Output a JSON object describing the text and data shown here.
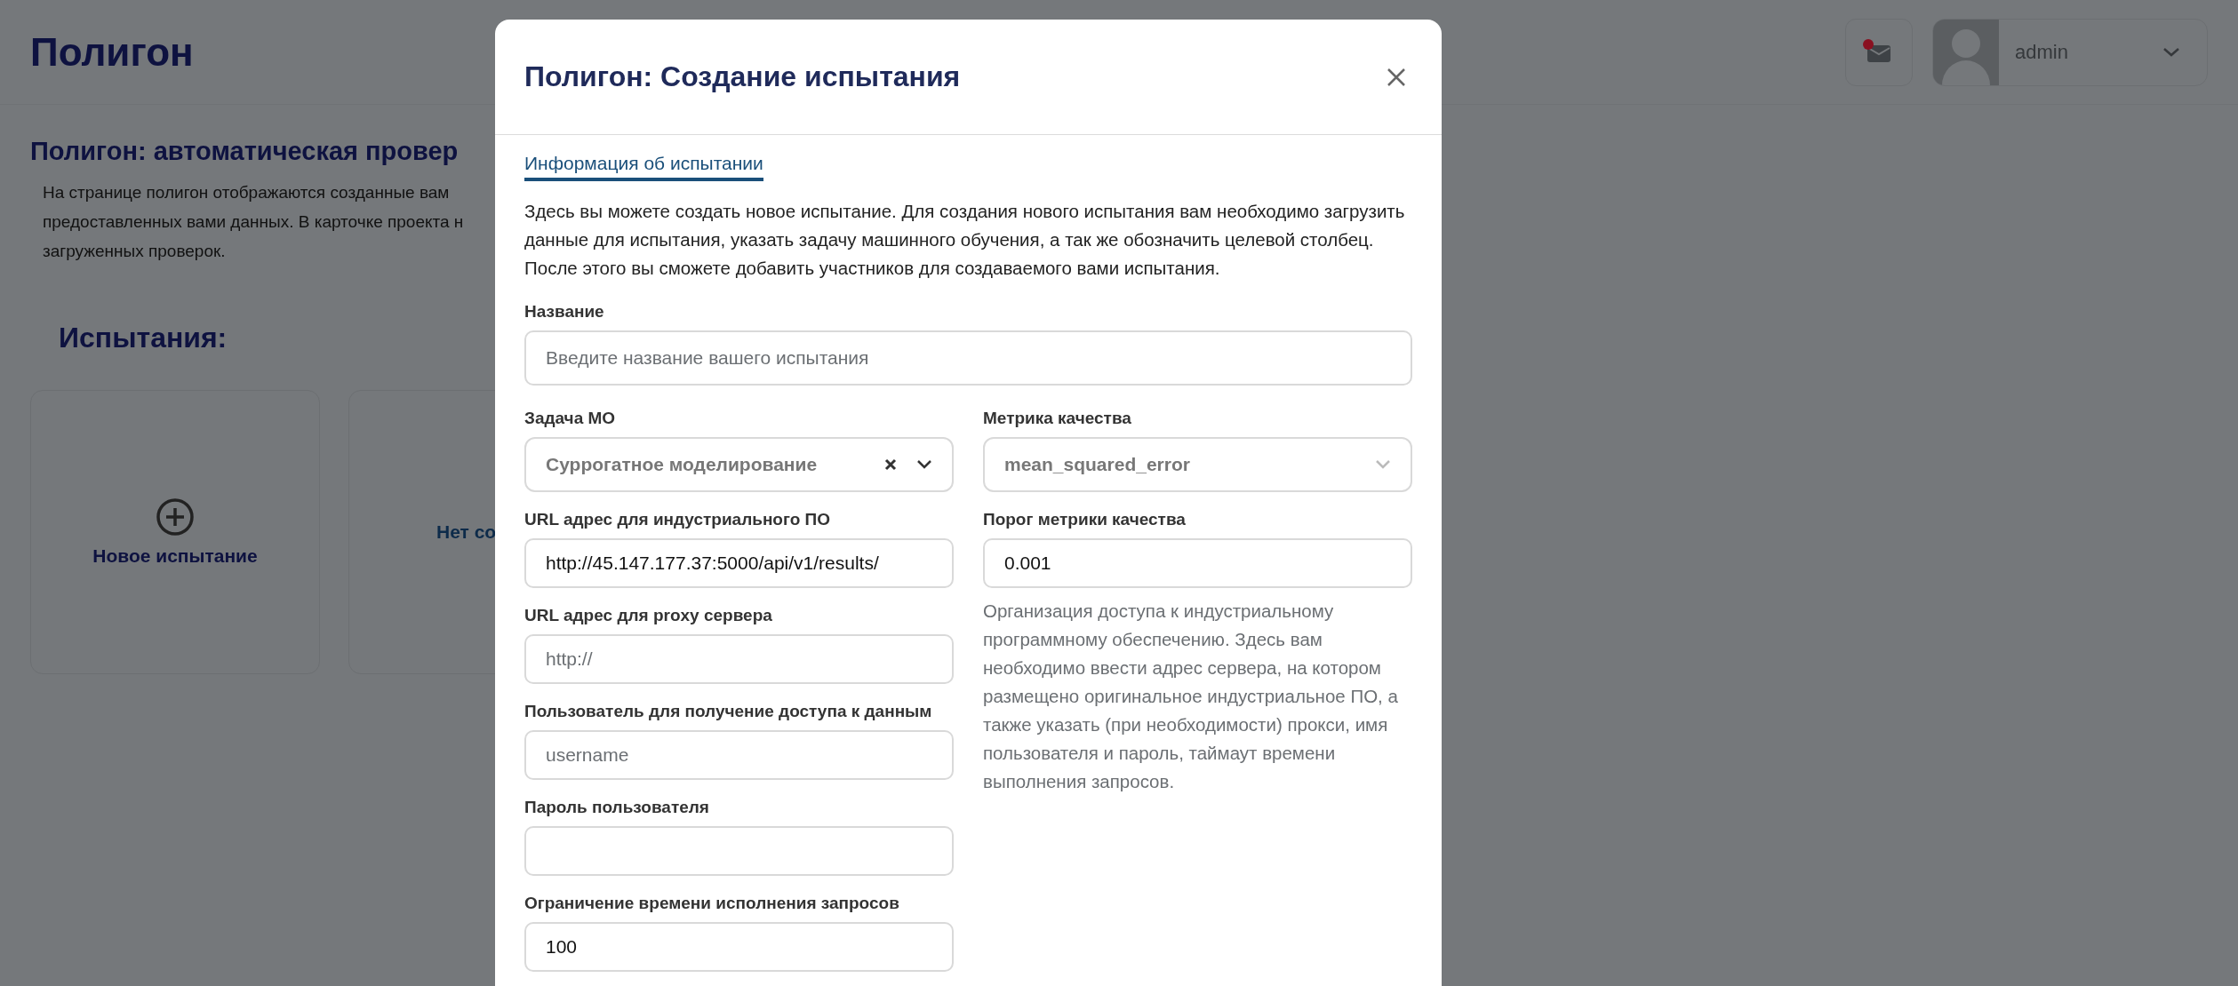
{
  "page": {
    "title": "Полигон",
    "notifications": {
      "unread": true
    },
    "user": {
      "name": "admin"
    },
    "heading": "Полигон: автоматическая провер",
    "description_lines": [
      "На странице полигон отображаются созданные вам",
      "предоставленных вами данных. В карточке проекта н",
      "загруженных проверок."
    ],
    "section_title": "Испытания:",
    "cards": [
      {
        "kind": "new",
        "label": "Новое испытание"
      },
      {
        "kind": "empty",
        "label": "Нет со"
      }
    ]
  },
  "modal": {
    "title": "Полигон: Создание испытания",
    "tabs": [
      {
        "label": "Информация об испытании",
        "selected": true
      }
    ],
    "intro": "Здесь вы можете создать новое испытание. Для создания нового испытания вам необходимо загрузить данные для испытания, указать задачу машинного обучения, а так же обозначить целевой столбец. После этого вы сможете добавить участников для создаваемого вами испытания.",
    "name_field": {
      "label": "Название",
      "placeholder": "Введите название вашего испытания"
    },
    "left_fields": [
      {
        "kind": "select",
        "label": "Задача МО",
        "value": "Суррогатное моделирование",
        "clearable": true
      },
      {
        "kind": "input",
        "label": "URL адрес для индустриального ПО",
        "value": "http://45.147.177.37:5000/api/v1/results/"
      },
      {
        "kind": "input",
        "label": "URL адрес для proxy сервера",
        "placeholder": "http://"
      },
      {
        "kind": "input",
        "label": "Пользователь для получение доступа к данным",
        "placeholder": "username"
      },
      {
        "kind": "input",
        "label": "Пароль пользователя"
      },
      {
        "kind": "input",
        "label": "Ограничение времени исполнения запросов",
        "value": "100"
      }
    ],
    "right_fields": [
      {
        "kind": "select",
        "label": "Метрика качества",
        "value": "mean_squared_error"
      },
      {
        "kind": "input",
        "label": "Порог метрики качества",
        "value": "0.001"
      }
    ],
    "help_text": "Организация доступа к индустриальному программному обеспечению. Здесь вам необходимо ввести адрес сервера, на котором размещено оригинальное индустриальное ПО, а также указать (при необходимости) прокси, имя пользователя и пароль, таймаут времени выполнения запросов."
  }
}
